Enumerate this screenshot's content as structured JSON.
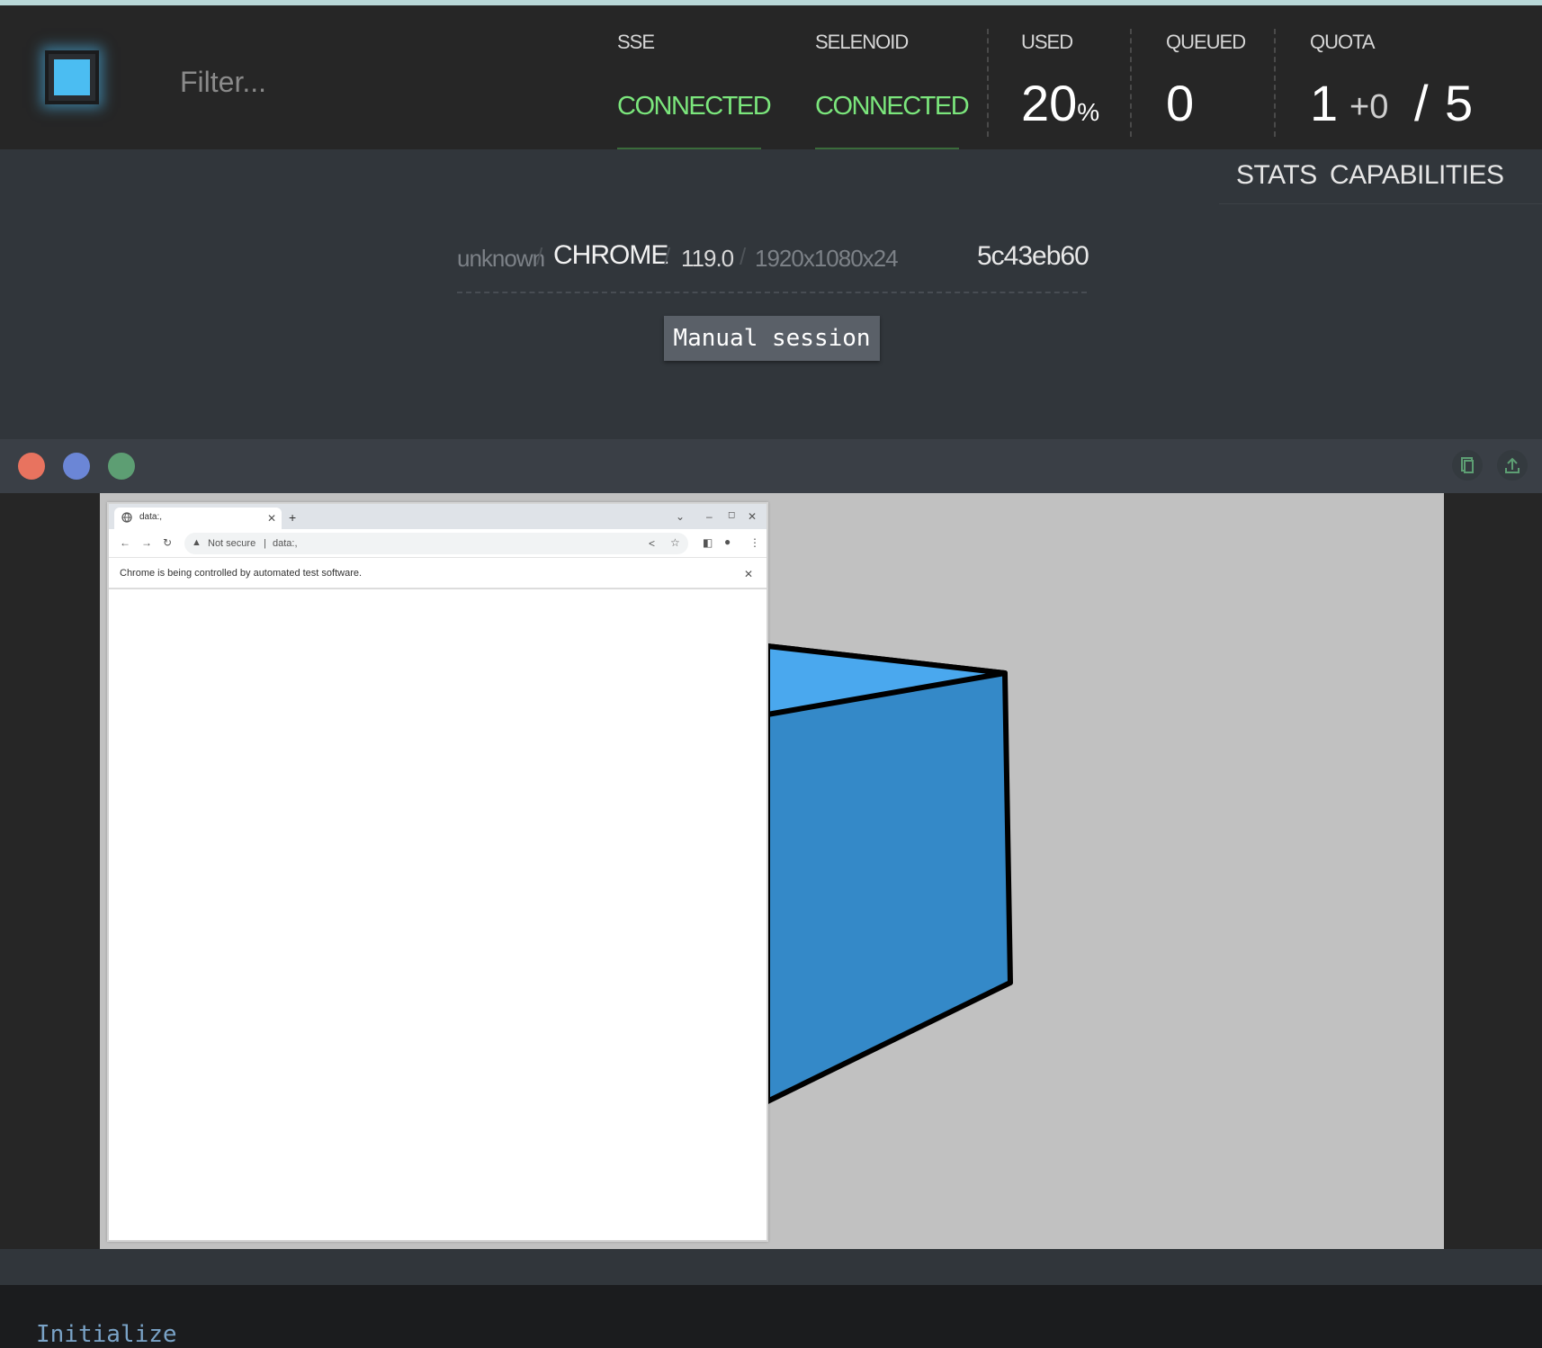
{
  "header": {
    "filter_placeholder": "Filter...",
    "sse": {
      "label": "SSE",
      "status": "CONNECTED"
    },
    "selenoid": {
      "label": "SELENOID",
      "status": "CONNECTED"
    },
    "used": {
      "label": "USED",
      "value": "20",
      "unit": "%"
    },
    "queued": {
      "label": "QUEUED",
      "value": "0"
    },
    "quota": {
      "label": "QUOTA",
      "used": "1",
      "plus": "+0",
      "slash": "/",
      "total": "5"
    }
  },
  "tabs": {
    "stats": "STATS",
    "capabilities": "CAPABILITIES"
  },
  "session": {
    "platform": "unknown",
    "browser": "CHROME",
    "version": "119.0",
    "resolution": "1920x1080x24",
    "id": "5c43eb60",
    "manual_label": "Manual session"
  },
  "vnc": {
    "chrome": {
      "tab_title": "data:,",
      "security": "Not secure",
      "url": "data:,",
      "infobar": "Chrome is being controlled by automated test software."
    }
  },
  "log": {
    "text": "Initialize"
  },
  "colors": {
    "accent": "#4bbdf2",
    "connected": "#7be67c",
    "dot_red": "#e8735f",
    "dot_blue": "#6b86d6",
    "dot_green": "#5d9e73"
  }
}
